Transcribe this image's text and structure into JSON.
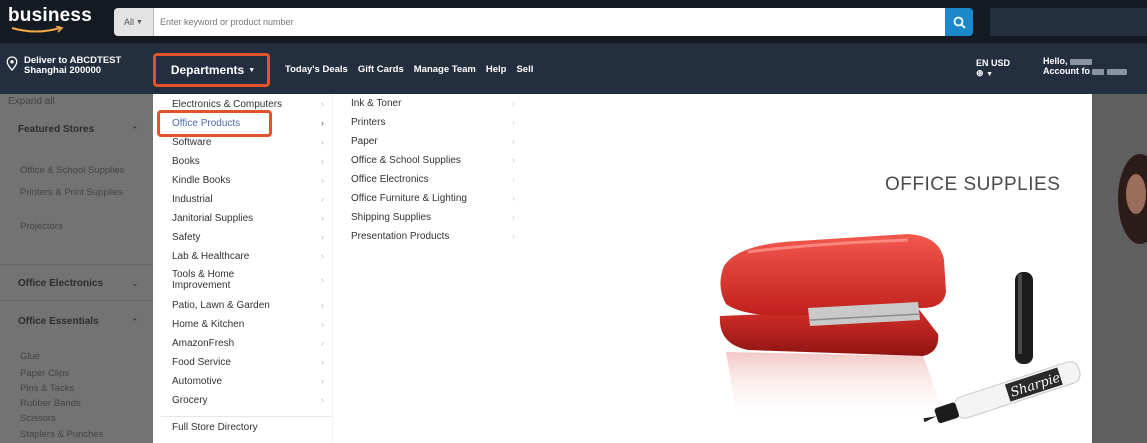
{
  "header": {
    "logo": "business",
    "search_scope": "All",
    "search_placeholder": "Enter keyword or product number"
  },
  "nav": {
    "deliver_line1": "Deliver to ABCDTEST",
    "deliver_line2": "Shanghai 200000",
    "departments_label": "Departments",
    "links": [
      "Today's Deals",
      "Gift Cards",
      "Manage Team",
      "Help",
      "Sell"
    ],
    "lang_code": "EN",
    "currency": "USD",
    "greeting": "Hello,",
    "account_label": "Account fo"
  },
  "sidebar": {
    "expand_label": "Expand all",
    "sections": [
      {
        "title": "Featured Stores",
        "items": [
          "Office & School Supplies",
          "Printers & Print Supplies",
          "Projectors"
        ]
      },
      {
        "title": "Office Electronics",
        "items": []
      },
      {
        "title": "Office Essentials",
        "items": [
          "Glue",
          "Paper Clips",
          "Pins & Tacks",
          "Rubber Bands",
          "Scissors",
          "Staplers & Punches"
        ]
      }
    ]
  },
  "departments": {
    "items": [
      "Electronics & Computers",
      "Office Products",
      "Software",
      "Books",
      "Kindle Books",
      "Industrial",
      "Janitorial Supplies",
      "Safety",
      "Lab & Healthcare",
      "Tools & Home Improvement",
      "Patio, Lawn & Garden",
      "Home & Kitchen",
      "AmazonFresh",
      "Food Service",
      "Automotive",
      "Grocery"
    ],
    "selected": "Office Products",
    "footer": "Full Store Directory"
  },
  "subcategories": {
    "items": [
      "Ink & Toner",
      "Printers",
      "Paper",
      "Office & School Supplies",
      "Office Electronics",
      "Office Furniture & Lighting",
      "Shipping Supplies",
      "Presentation Products"
    ]
  },
  "promo": {
    "title": "OFFICE SUPPLIES"
  },
  "colors": {
    "header_bg": "#131a22",
    "nav_bg": "#232f3e",
    "search_button": "#1b88c9",
    "highlight": "#e4522b",
    "selected_link": "#4a6cb0"
  }
}
